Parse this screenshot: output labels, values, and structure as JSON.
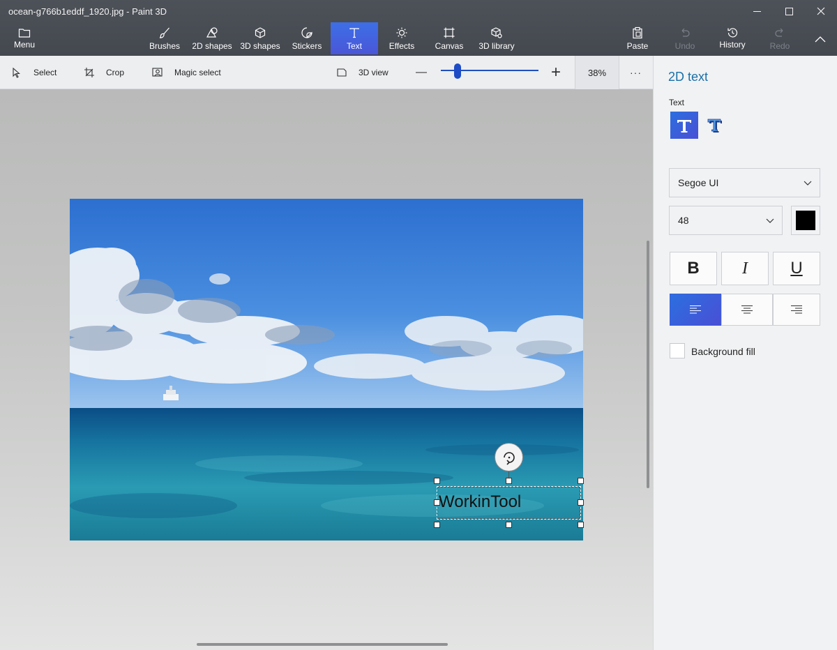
{
  "window": {
    "title": "ocean-g766b1eddf_1920.jpg - Paint 3D",
    "minimize": "—",
    "maximize": "☐",
    "close": "✕"
  },
  "ribbon": {
    "menu": "Menu",
    "tools": [
      {
        "label": "Brushes",
        "icon": "brush-icon"
      },
      {
        "label": "2D shapes",
        "icon": "2d-shapes-icon"
      },
      {
        "label": "3D shapes",
        "icon": "3d-shapes-icon"
      },
      {
        "label": "Stickers",
        "icon": "sticker-icon"
      },
      {
        "label": "Text",
        "icon": "text-icon",
        "active": true
      },
      {
        "label": "Effects",
        "icon": "effects-icon"
      },
      {
        "label": "Canvas",
        "icon": "canvas-icon"
      },
      {
        "label": "3D library",
        "icon": "3d-library-icon"
      }
    ],
    "paste": "Paste",
    "undo": "Undo",
    "history": "History",
    "redo": "Redo"
  },
  "toolbar": {
    "select": "Select",
    "crop": "Crop",
    "magic_select": "Magic select",
    "view_3d": "3D view",
    "zoom_minus": "—",
    "zoom_plus": "+",
    "zoom_percent": "38%",
    "zoom_level": 0.38,
    "more": "···"
  },
  "canvas": {
    "text_object": "WorkinTool"
  },
  "panel": {
    "title": "2D text",
    "text_label": "Text",
    "font_family": "Segoe UI",
    "font_size": "48",
    "text_color": "#000000",
    "bold": "B",
    "italic": "I",
    "underline": "U",
    "background_fill": "Background fill",
    "accent_color": "#3d6fe6"
  }
}
